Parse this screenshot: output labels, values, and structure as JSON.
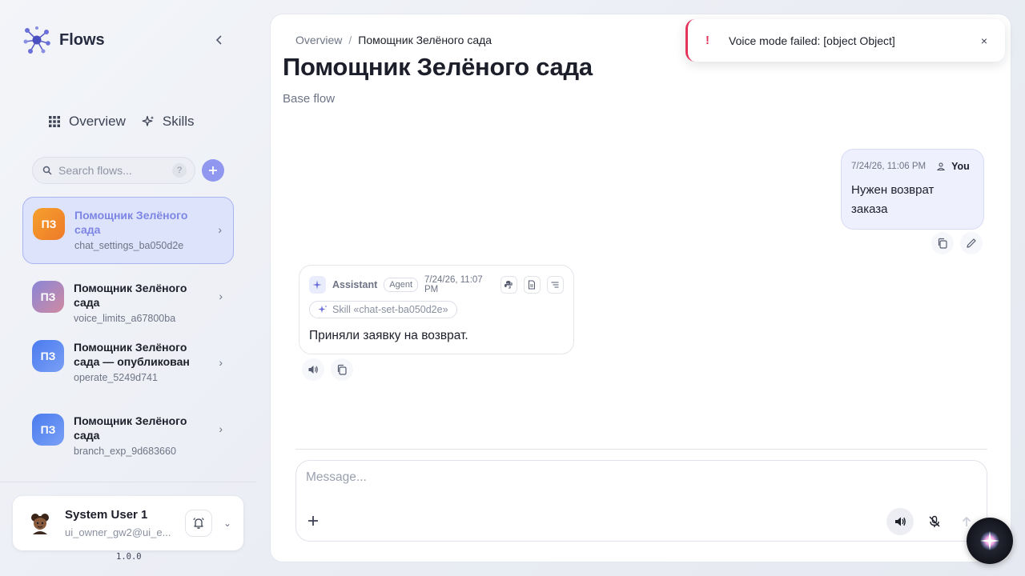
{
  "app": {
    "name": "Flows",
    "version": "1.0.0"
  },
  "nav": {
    "overview": "Overview",
    "skills": "Skills"
  },
  "search": {
    "placeholder": "Search flows...",
    "help": "?"
  },
  "flows": [
    {
      "initials": "ПЗ",
      "title": "Помощник Зелёного сада",
      "id": "chat_settings_ba050d2e",
      "color": "#f08a2a",
      "active": true
    },
    {
      "initials": "ПЗ",
      "title": "Помощник Зелёного сада",
      "id": "voice_limits_a67800ba",
      "color": "#a67bb8",
      "active": false
    },
    {
      "initials": "ПЗ",
      "title": "Помощник Зелёного сада — опубликован",
      "id": "operate_5249d741",
      "color": "#5a86f0",
      "active": false
    },
    {
      "initials": "ПЗ",
      "title": "Помощник Зелёного сада",
      "id": "branch_exp_9d683660",
      "color": "#5a86f0",
      "active": false
    }
  ],
  "user": {
    "name": "System User 1",
    "email": "ui_owner_gw2@ui_e..."
  },
  "breadcrumb": {
    "root": "Overview",
    "separator": "/",
    "current": "Помощник Зелёного сада"
  },
  "page": {
    "title": "Помощник Зелёного сада",
    "subtitle": "Base flow"
  },
  "messages": {
    "user": {
      "time": "7/24/26, 11:06 PM",
      "author": "You",
      "text": "Нужен возврат заказа"
    },
    "assistant": {
      "author": "Assistant",
      "badge": "Agent",
      "time": "7/24/26, 11:07 PM",
      "skill": "Skill «chat-set-ba050d2e»",
      "text": "Приняли заявку на возврат."
    }
  },
  "composer": {
    "placeholder": "Message..."
  },
  "toast": {
    "icon": "!",
    "text": "Voice mode failed: [object Object]",
    "close": "×"
  },
  "colors": {
    "accent": "#8f97ef",
    "error": "#e5345a"
  }
}
